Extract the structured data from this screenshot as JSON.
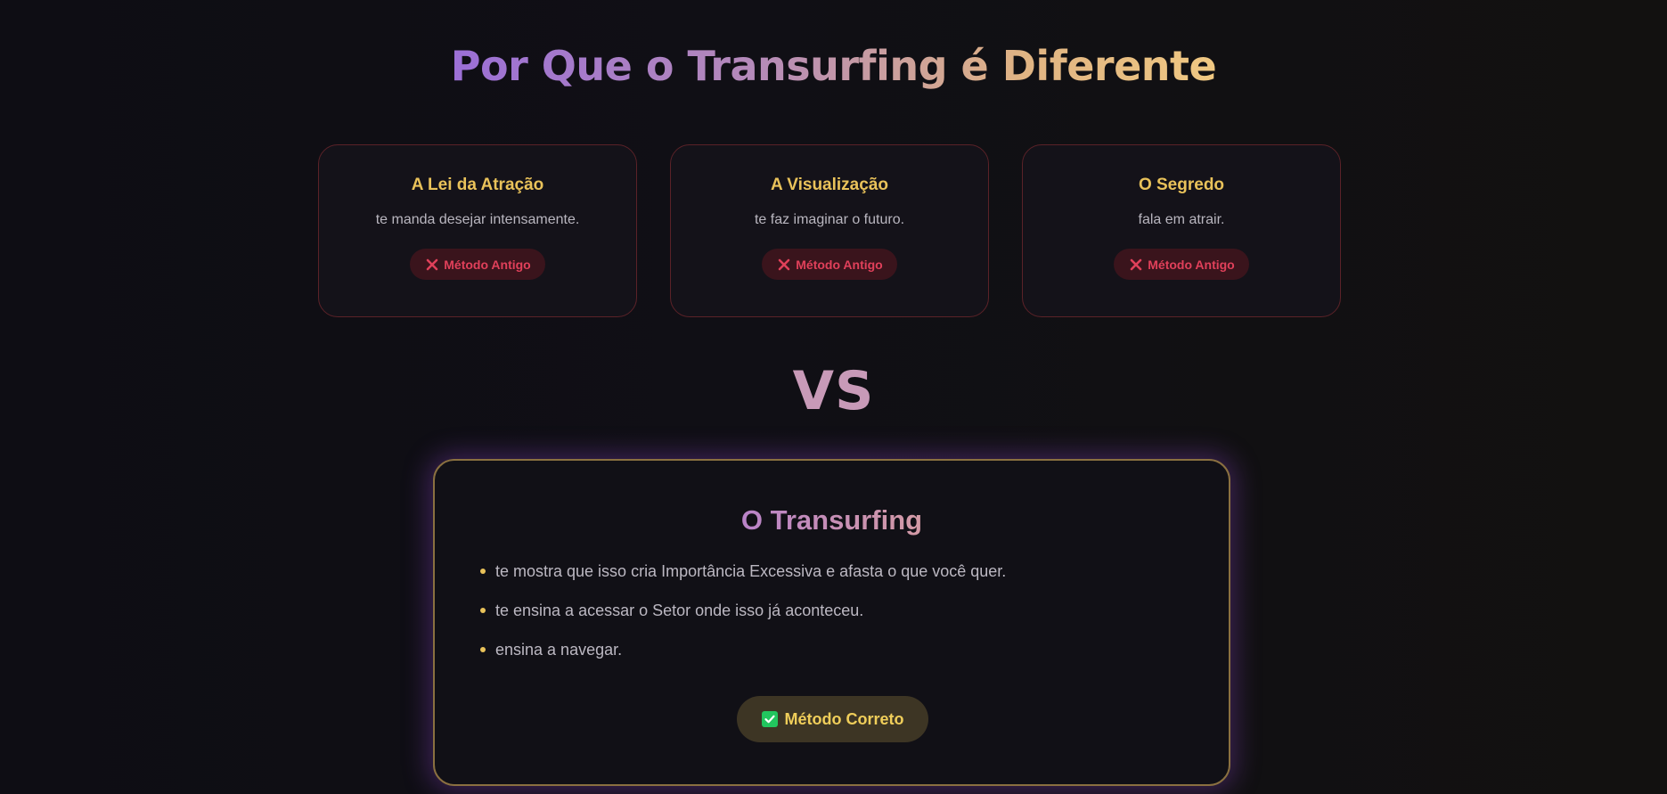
{
  "title": "Por Que o Transurfing é Diferente",
  "cards": [
    {
      "title": "A Lei da Atração",
      "description": "te manda desejar intensamente.",
      "badge": "Método Antigo"
    },
    {
      "title": "A Visualização",
      "description": "te faz imaginar o futuro.",
      "badge": "Método Antigo"
    },
    {
      "title": "O Segredo",
      "description": "fala em atrair.",
      "badge": "Método Antigo"
    }
  ],
  "vs": "VS",
  "main": {
    "title": "O Transurfing",
    "points": [
      "te mostra que isso cria Importância Excessiva e afasta o que você quer.",
      "te ensina a acessar o Setor onde isso já aconteceu.",
      "ensina a navegar."
    ],
    "badge": "Método Correto"
  },
  "icons": {
    "old_badge_icon": "x-icon",
    "correct_badge_icon": "check-icon"
  },
  "colors": {
    "accent_gold": "#e9c25a",
    "error_red": "#e0405a",
    "success_green": "#22c55e",
    "title_purple": "#9b6fd6"
  }
}
